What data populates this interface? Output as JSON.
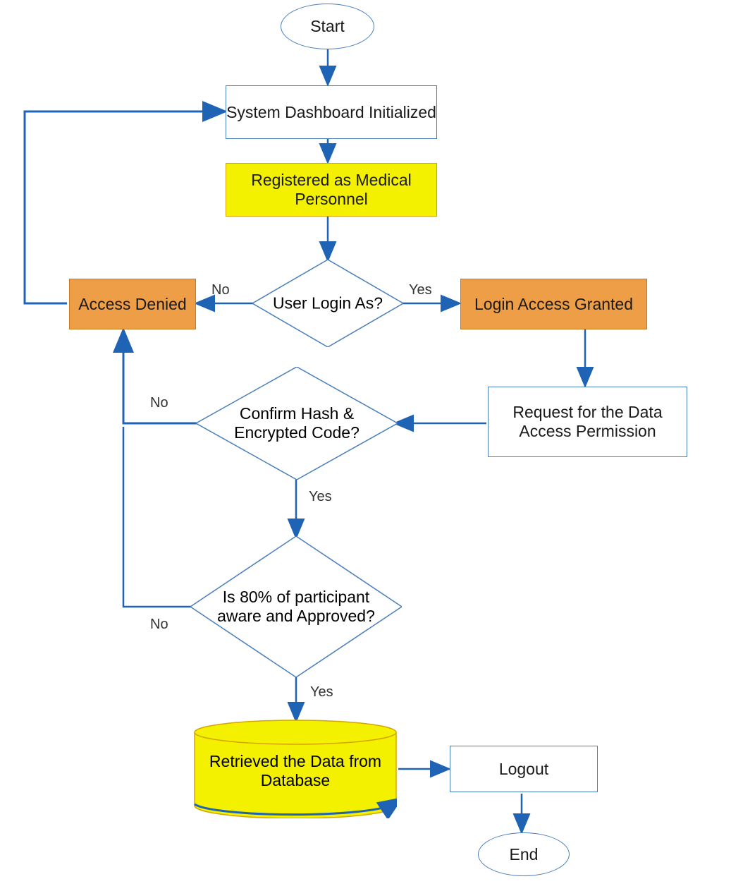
{
  "colors": {
    "blue_stroke": "#4a7ebb",
    "blue_arrow": "#1f63b5",
    "yellow_fill": "#f3f000",
    "yellow_stroke": "#d4a500",
    "orange_fill": "#ed9e47",
    "orange_stroke": "#c77a1a"
  },
  "nodes": {
    "start": "Start",
    "init": "System Dashboard Initialized",
    "registered": "Registered as Medical Personnel",
    "decision_login": "User Login As?",
    "access_denied": "Access Denied",
    "login_granted": "Login Access Granted",
    "request_perm": "Request for the Data Access Permission",
    "decision_hash": "Confirm Hash & Encrypted Code?",
    "decision_80": "Is 80% of participant aware and Approved?",
    "retrieved": "Retrieved the Data from Database",
    "logout": "Logout",
    "end": "End"
  },
  "edge_labels": {
    "login_no": "No",
    "login_yes": "Yes",
    "hash_no": "No",
    "hash_yes": "Yes",
    "eighty_no": "No",
    "eighty_yes": "Yes"
  }
}
